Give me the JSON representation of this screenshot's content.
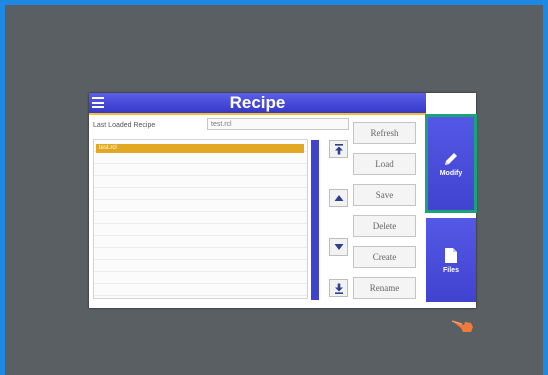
{
  "screen": {
    "title": "Recipe",
    "last_loaded_label": "Last Loaded Recipe",
    "last_loaded_value": "test.rcl"
  },
  "recipe_list": {
    "items": [
      "test.rcl"
    ]
  },
  "actions": {
    "refresh": "Refresh",
    "load": "Load",
    "save": "Save",
    "delete": "Delete",
    "create": "Create",
    "rename": "Rename"
  },
  "side_menu": {
    "modify": "Modify",
    "files": "Files"
  },
  "icons": {
    "menu": "hamburger-menu-icon",
    "scroll_top": "double-up-arrow-icon",
    "scroll_up": "up-arrow-icon",
    "scroll_down": "down-arrow-icon",
    "scroll_bottom": "double-down-arrow-icon",
    "modify": "pencil-icon",
    "files": "document-icon",
    "hand": "pointing-hand-icon"
  },
  "colors": {
    "accent": "#3f43cf",
    "selection": "#e3a821",
    "highlight": "#1aa37a",
    "frame": "#1e88e5"
  }
}
